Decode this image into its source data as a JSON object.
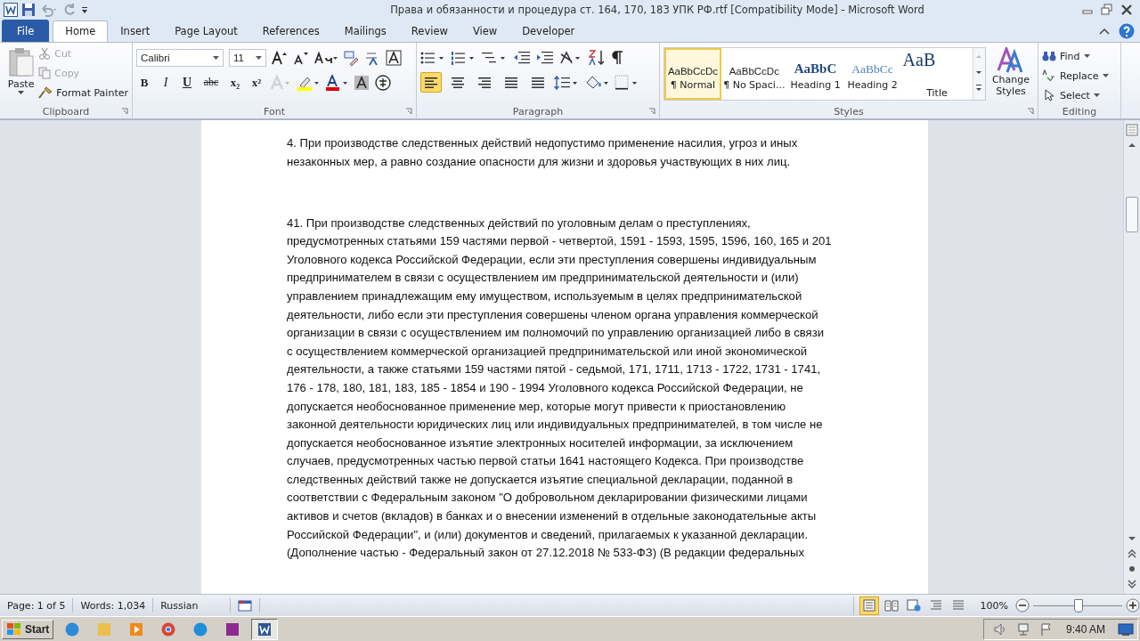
{
  "window": {
    "title": "Права и обязанности и процедура ст. 164, 170, 183 УПК РФ.rtf [Compatibility Mode]  -  Microsoft Word"
  },
  "tabs": [
    {
      "label": "File",
      "selected": false,
      "kind": "file"
    },
    {
      "label": "Home",
      "selected": true,
      "kind": "tab"
    },
    {
      "label": "Insert",
      "selected": false,
      "kind": "tab"
    },
    {
      "label": "Page Layout",
      "selected": false,
      "kind": "tab"
    },
    {
      "label": "References",
      "selected": false,
      "kind": "tab"
    },
    {
      "label": "Mailings",
      "selected": false,
      "kind": "tab"
    },
    {
      "label": "Review",
      "selected": false,
      "kind": "tab"
    },
    {
      "label": "View",
      "selected": false,
      "kind": "tab"
    },
    {
      "label": "Developer",
      "selected": false,
      "kind": "tab"
    }
  ],
  "clipboard": {
    "label": "Clipboard",
    "paste": "Paste",
    "items": [
      {
        "label": "Cut",
        "disabled": true,
        "kind": "cut"
      },
      {
        "label": "Copy",
        "disabled": true,
        "kind": "copy"
      },
      {
        "label": "Format Painter",
        "disabled": false,
        "kind": "painter"
      }
    ]
  },
  "font": {
    "label": "Font",
    "font_name": "Calibri",
    "font_size": "11",
    "format_buttons": [
      {
        "glyph": "B",
        "kind": "bold"
      },
      {
        "glyph": "I",
        "kind": "italic"
      },
      {
        "glyph": "U",
        "kind": "underline"
      },
      {
        "glyph": "abc",
        "kind": "strike"
      },
      {
        "glyph": "x₂",
        "kind": "sub"
      },
      {
        "glyph": "x²",
        "kind": "sup"
      }
    ]
  },
  "paragraph": {
    "label": "Paragraph",
    "align_buttons": [
      {
        "kind": "left",
        "selected": true
      },
      {
        "kind": "center",
        "selected": false
      },
      {
        "kind": "right",
        "selected": false
      },
      {
        "kind": "justify",
        "selected": false
      },
      {
        "kind": "distributed",
        "selected": false
      }
    ]
  },
  "styles": {
    "label": "Styles",
    "items": [
      {
        "preview": "AaBbCcDc",
        "name": "¶ Normal",
        "kind": "normal",
        "selected": true
      },
      {
        "preview": "AaBbCcDc",
        "name": "¶ No Spaci...",
        "kind": "normal",
        "selected": false
      },
      {
        "preview": "AaBbC",
        "name": "Heading 1",
        "kind": "heading1",
        "selected": false
      },
      {
        "preview": "AaBbCc",
        "name": "Heading 2",
        "kind": "heading2",
        "selected": false
      },
      {
        "preview": "AaB",
        "name": "Title",
        "kind": "title",
        "selected": false
      }
    ],
    "change_styles": "Change Styles"
  },
  "editing": {
    "label": "Editing",
    "items": [
      {
        "label": "Find",
        "kind": "find"
      },
      {
        "label": "Replace",
        "kind": "replace"
      },
      {
        "label": "Select",
        "kind": "select"
      }
    ]
  },
  "document": {
    "paragraphs": [
      {
        "lines": [
          "4. При производстве следственных действий недопустимо применение насилия, угроз и иных",
          "незаконных мер, а равно создание опасности для жизни и здоровья участвующих в них лиц."
        ]
      },
      {
        "lines": [
          "41.  При производстве следственных действий по уголовным делам о преступлениях,",
          "предусмотренных статьями 159 частями первой - четвертой, 1591 - 1593,  1595,  1596,  160,  165  и 201",
          "Уголовного кодекса Российской Федерации, если эти преступления совершены индивидуальным",
          "предпринимателем в связи с осуществлением им предпринимательской деятельности и (или)",
          "управлением принадлежащим ему имуществом, используемым в целях предпринимательской",
          "деятельности, либо если эти преступления совершены членом органа управления коммерческой",
          "организации в связи  с осуществлением им полномочий по управлению организацией либо в связи",
          "с осуществлением коммерческой организацией предпринимательской или иной экономической",
          "деятельности, а также статьями 159 частями пятой - седьмой, 171,  1711,  1713  - 1722,  1731  - 1741,",
          "176  - 178,  180,  181,  183,  185  - 1854  и 190  - 1994  Уголовного кодекса Российской Федерации, не",
          "допускается необоснованное применение мер, которые могут привести к приостановлению",
          "законной деятельности юридических лиц или индивидуальных предпринимателей, в том числе не",
          "допускается необоснованное изъятие электронных носителей информации, за исключением",
          "случаев, предусмотренных частью первой статьи 1641  настоящего Кодекса. При производстве",
          "следственных действий также не допускается изъятие специальной декларации, поданной в",
          "соответствии с Федеральным законом \"О добровольном декларировании физическими лицами",
          "активов и счетов (вкладов) в банках и о внесении изменений в отдельные законодательные акты",
          "Российской Федерации\", и (или) документов и сведений, прилагаемых к указанной декларации.",
          "(Дополнение частью - Федеральный закон от 27.12.2018  № 533-ФЗ) (В редакции федеральных"
        ]
      }
    ]
  },
  "status_bar": {
    "page": "Page: 1 of 5",
    "words": "Words: 1,034",
    "language": "Russian",
    "views": [
      {
        "kind": "print",
        "selected": true
      },
      {
        "kind": "reading",
        "selected": false
      },
      {
        "kind": "web",
        "selected": false
      },
      {
        "kind": "outline",
        "selected": false
      },
      {
        "kind": "draft",
        "selected": false
      }
    ],
    "zoom": "100%",
    "zoom_slider": {
      "level": 0.5
    }
  },
  "taskbar": {
    "start": "Start",
    "apps": [
      {
        "kind": "ie",
        "selected": false
      },
      {
        "kind": "explorer",
        "selected": false
      },
      {
        "kind": "media",
        "selected": false
      },
      {
        "kind": "chrome",
        "selected": false
      },
      {
        "kind": "edge",
        "selected": false
      },
      {
        "kind": "winrar",
        "selected": false
      },
      {
        "kind": "word",
        "selected": true
      }
    ],
    "clock": "9:40 AM"
  }
}
